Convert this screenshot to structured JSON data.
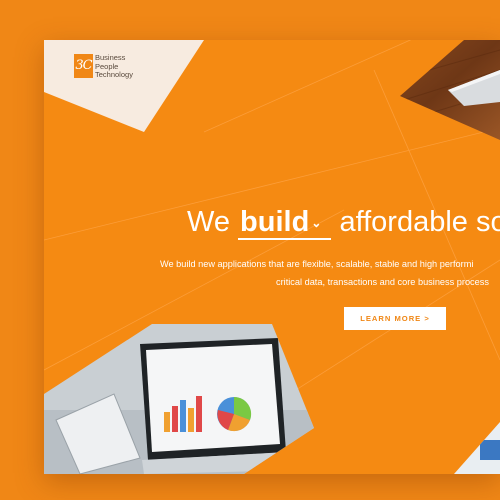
{
  "logo": {
    "mark": "3C",
    "lines": [
      "Business",
      "People",
      "Technology"
    ]
  },
  "hero": {
    "headline_prefix": "We",
    "headline_word": "build",
    "headline_suffix": "affordable so",
    "subtext_line1": "We build new applications that are flexible, scalable, stable and high performi",
    "subtext_line2": "critical data, transactions and core business process"
  },
  "cta": {
    "label": "LEARN MORE >"
  },
  "colors": {
    "background": "#f08716",
    "page": "#f58a12",
    "logo_panel": "#f7ebe0",
    "text": "#ffffff"
  },
  "icons": {
    "dropdown": "chevron-down-icon"
  }
}
